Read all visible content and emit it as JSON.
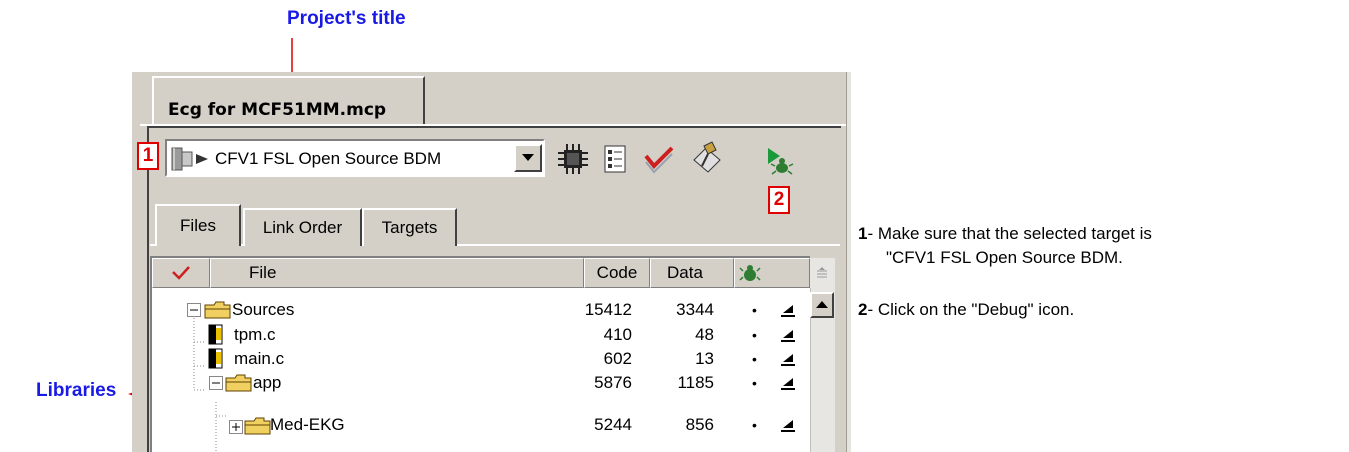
{
  "annotations": {
    "project_title": "Project's title",
    "libraries": "Libraries",
    "badge1": "1",
    "badge2": "2"
  },
  "project_tab": {
    "label": "Ecg for MCF51MM.mcp"
  },
  "target": {
    "selected": "CFV1 FSL Open Source BDM"
  },
  "subtabs": [
    {
      "label": "Files"
    },
    {
      "label": "Link Order"
    },
    {
      "label": "Targets"
    }
  ],
  "columns": {
    "file": "File",
    "code": "Code",
    "data": "Data"
  },
  "rows": [
    {
      "name": "Sources",
      "code": "15412",
      "data": "3344",
      "dot": "•"
    },
    {
      "name": "tpm.c",
      "code": "410",
      "data": "48",
      "dot": "•"
    },
    {
      "name": "main.c",
      "code": "602",
      "data": "13",
      "dot": "•"
    },
    {
      "name": "app",
      "code": "5876",
      "data": "1185",
      "dot": "•"
    },
    {
      "name": "Med-EKG",
      "code": "5244",
      "data": "856",
      "dot": "•"
    }
  ],
  "instructions": [
    {
      "num": "1",
      "sep": "-",
      "line1": " Make sure that the selected target is",
      "line2": "\"CFV1 FSL Open Source BDM."
    },
    {
      "num": "2",
      "sep": "-",
      "line1": " Click on the \"Debug\" icon."
    }
  ],
  "colors": {
    "annotation_blue": "#1a1ae6",
    "annotation_red": "#e00000",
    "panel_gray": "#d4d0c8"
  }
}
